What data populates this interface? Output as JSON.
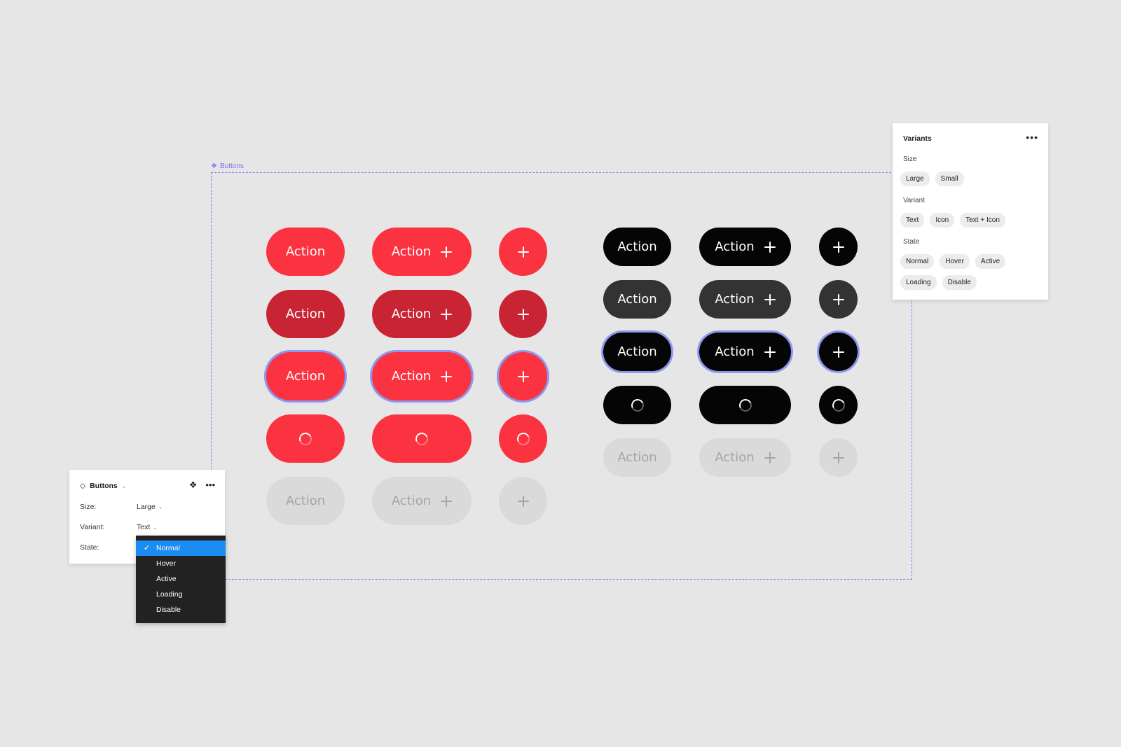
{
  "frame": {
    "label": "Buttons"
  },
  "buttons": {
    "label": "Action"
  },
  "props_panel": {
    "title": "Buttons",
    "size_label": "Size:",
    "size_value": "Large",
    "variant_label": "Variant:",
    "variant_value": "Text",
    "state_label": "State:",
    "state_options": [
      "Normal",
      "Hover",
      "Active",
      "Loading",
      "Disable"
    ],
    "selected_state": "Normal"
  },
  "variants_panel": {
    "title": "Variants",
    "size_label": "Size",
    "size_options": [
      "Large",
      "Small"
    ],
    "variant_label": "Variant",
    "variant_options": [
      "Text",
      "Icon",
      "Text + Icon"
    ],
    "state_label": "State",
    "state_options": [
      "Normal",
      "Hover",
      "Active",
      "Loading",
      "Disable"
    ]
  },
  "colors": {
    "canvas": "#e6e6e6",
    "red_primary": "#fb3240",
    "red_hover": "#c92433",
    "black": "#050505",
    "black_hover": "#333333",
    "focus_ring": "#8d97ee",
    "disabled_bg": "#dadada",
    "disabled_text": "#a5a5a5",
    "selection_blue": "#1b8cf1",
    "frame_dash": "#8a7cf0"
  }
}
